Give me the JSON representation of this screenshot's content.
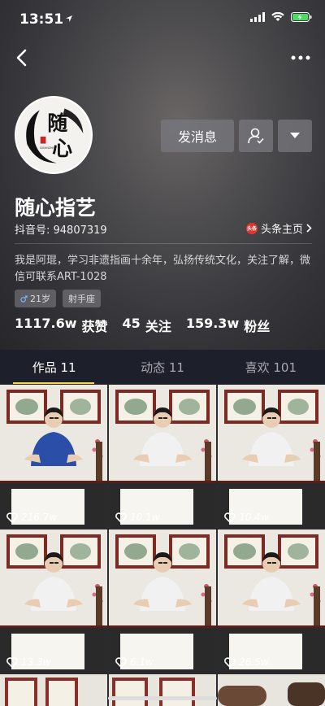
{
  "status_bar": {
    "time": "13:51"
  },
  "profile": {
    "avatar_text_1": "随",
    "avatar_text_2": "心",
    "avatar_small_text": "SUIXINZHIYI",
    "name": "随心指艺",
    "douyin_id": "抖音号: 94807319",
    "toutiao_badge": "头条",
    "toutiao_link": "头条主页",
    "bio": "我是阿琨，学习非遗指画十余年，弘扬传统文化，关注了解，微信可联系ART-1028",
    "tags": [
      "21岁",
      "射手座"
    ],
    "stats": [
      {
        "value": "1117.6w",
        "label": "获赞"
      },
      {
        "value": "45",
        "label": "关注"
      },
      {
        "value": "159.3w",
        "label": "粉丝"
      }
    ]
  },
  "actions": {
    "message_label": "发消息"
  },
  "tabs": [
    {
      "label": "作品 11",
      "active": true
    },
    {
      "label": "动态 11",
      "active": false
    },
    {
      "label": "喜欢 101",
      "active": false
    }
  ],
  "videos": [
    {
      "likes": "216.7w",
      "shirt": "#2b4fa8"
    },
    {
      "likes": "10.1w",
      "shirt": "#f1f1f1"
    },
    {
      "likes": "10.4w",
      "shirt": "#f1f1f1"
    },
    {
      "likes": "13.3w",
      "shirt": "#f1f1f1"
    },
    {
      "likes": "6.1w",
      "shirt": "#f1f1f1"
    },
    {
      "likes": "26.5w",
      "shirt": "#f1f1f1"
    }
  ],
  "colors": {
    "accent": "#f8d84a",
    "tab_bg": "#1d1f2a",
    "toutiao": "#e8322e"
  }
}
